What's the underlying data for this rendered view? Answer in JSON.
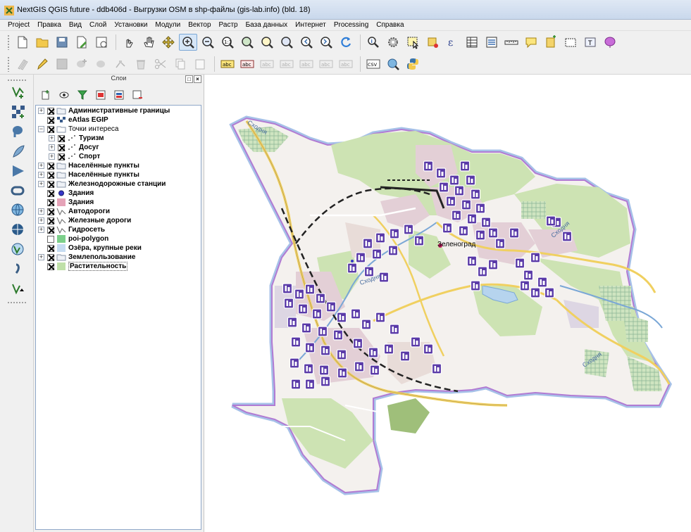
{
  "window": {
    "title": "NextGIS QGIS future - ddb406d - Выгрузки OSM в shp-файлы (gis-lab.info) (bld. 18)"
  },
  "menu": [
    "Project",
    "Правка",
    "Вид",
    "Слой",
    "Установки",
    "Модули",
    "Вектор",
    "Растр",
    "База данных",
    "Интернет",
    "Processing",
    "Справка"
  ],
  "toolbar_row1": [
    "new-project",
    "open-project",
    "save-project",
    "save-as",
    "print-composer",
    "touch-zoom",
    "pan",
    "pan-to-selection",
    "zoom-in",
    "zoom-out",
    "zoom-native",
    "zoom-full",
    "zoom-to-selection",
    "zoom-to-layer",
    "zoom-last",
    "zoom-next",
    "refresh",
    "identify",
    "run-feature-action",
    "select-features",
    "deselect",
    "field-calculator",
    "open-attribute-table",
    "statistics",
    "measure-line",
    "map-tips",
    "new-bookmark",
    "show-bookmarks",
    "text-annotation",
    "style-manager"
  ],
  "toolbar_row2": [
    "current-edits",
    "toggle-editing",
    "save-edits",
    "add-feature",
    "move-feature",
    "node-tool",
    "delete-selected",
    "cut-features",
    "copy-features",
    "paste-features",
    "layer-labeling",
    "pin-labels",
    "show-labels",
    "move-label",
    "rotate-label",
    "change-label",
    "csv",
    "georeferencer",
    "python-console"
  ],
  "side_toolbar": [
    "add-vector-layer",
    "add-raster-layer",
    "add-postgis-layer",
    "add-spatialite-layer",
    "add-mssql-layer",
    "add-oracle-layer",
    "add-wms-layer",
    "add-wcs-layer",
    "add-wfs-layer",
    "add-delimited-text-layer",
    "new-shapefile-layer"
  ],
  "layers_panel": {
    "title": "Слои",
    "layers": [
      {
        "name": "Административные границы",
        "bold": true,
        "checked": true,
        "expandable": true,
        "indent": 0,
        "symbol": "group"
      },
      {
        "name": "eAtlas EGIP",
        "bold": true,
        "checked": true,
        "expandable": false,
        "indent": 0,
        "symbol": "raster"
      },
      {
        "name": "Точки интереса",
        "bold": false,
        "checked": true,
        "expandable": true,
        "expanded": true,
        "indent": 0,
        "symbol": "group-open"
      },
      {
        "name": "Туризм",
        "bold": true,
        "checked": true,
        "expandable": true,
        "indent": 1,
        "symbol": "points"
      },
      {
        "name": "Досуг",
        "bold": true,
        "checked": true,
        "expandable": true,
        "indent": 1,
        "symbol": "points"
      },
      {
        "name": "Спорт",
        "bold": true,
        "checked": true,
        "expandable": true,
        "indent": 1,
        "symbol": "points"
      },
      {
        "name": "Населённые пункты",
        "bold": true,
        "checked": true,
        "expandable": true,
        "indent": 0,
        "symbol": "group"
      },
      {
        "name": "Населённые пункты",
        "bold": true,
        "checked": true,
        "expandable": true,
        "indent": 0,
        "symbol": "group"
      },
      {
        "name": "Железнодорожные станции",
        "bold": true,
        "checked": true,
        "expandable": true,
        "indent": 0,
        "symbol": "group"
      },
      {
        "name": "Здания",
        "bold": true,
        "checked": true,
        "expandable": false,
        "indent": 0,
        "symbol": "point-blue"
      },
      {
        "name": "Здания",
        "bold": true,
        "checked": true,
        "expandable": false,
        "indent": 0,
        "symbol": "fill-pink"
      },
      {
        "name": "Автодороги",
        "bold": true,
        "checked": true,
        "expandable": true,
        "indent": 0,
        "symbol": "line"
      },
      {
        "name": "Железные дороги",
        "bold": true,
        "checked": true,
        "expandable": true,
        "indent": 0,
        "symbol": "line"
      },
      {
        "name": "Гидросеть",
        "bold": true,
        "checked": true,
        "expandable": true,
        "indent": 0,
        "symbol": "line"
      },
      {
        "name": "poi-polygon",
        "bold": true,
        "checked": false,
        "expandable": false,
        "indent": 0,
        "symbol": "fill-green"
      },
      {
        "name": "Озёра, крупные реки",
        "bold": true,
        "checked": true,
        "expandable": false,
        "indent": 0,
        "symbol": "fill-lightblue"
      },
      {
        "name": "Землепользование",
        "bold": true,
        "checked": true,
        "expandable": true,
        "indent": 0,
        "symbol": "group"
      },
      {
        "name": "Растительность",
        "bold": true,
        "checked": true,
        "expandable": false,
        "indent": 0,
        "symbol": "fill-lightgreen",
        "selected": true
      }
    ]
  },
  "map": {
    "labels": {
      "city": "Зеленоград",
      "river_1": "Сходня",
      "river_2": "Сходня",
      "river_3": "Сходня",
      "river_4": "Сходня"
    },
    "colors": {
      "boundary": "#b17bd3",
      "boundary_halo": "#6a98d8",
      "vegetation": "#cde3b3",
      "buildings": "#e3cfd6",
      "poi": "#5a3aa8",
      "roads": "#f0d060"
    }
  }
}
